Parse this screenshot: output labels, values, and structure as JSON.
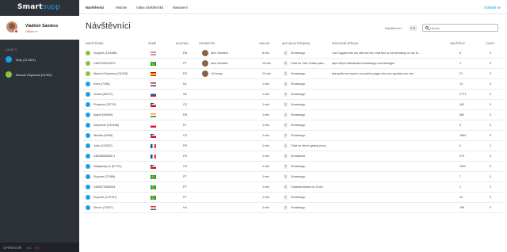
{
  "app": {
    "logo_main": "Smart",
    "logo_accent": "supp"
  },
  "user": {
    "name": "Vladimír Sandera",
    "status": "Offline"
  },
  "sidebar": {
    "chats_label": "CHATY",
    "chats": [
      {
        "label": "Amy (117501)",
        "type": "desktop"
      },
      {
        "label": "Manuel Espinosa (21003)",
        "type": "mobile"
      }
    ],
    "operators": {
      "label": "OPERÁTOŘI",
      "online": "1",
      "offline": "3"
    }
  },
  "nav": {
    "items": [
      "Návštěvníci",
      "Historie",
      "Videa návštěvníků",
      "Nastavení"
    ],
    "logout": "Odhlásit se"
  },
  "page": {
    "title": "Návštěvníci",
    "visitors_label": "Návštěvníci",
    "visitors_count": "271",
    "search_placeholder": "Hledat"
  },
  "table": {
    "headers": [
      "NÁVŠTĚVNÍK",
      "ZEMĚ",
      "SKUPINA",
      "OPERÁTOR",
      "ONLINE",
      "AKTUÁLNÍ STRÁNKA",
      "POSLEDNÍ ZPRÁVA",
      "NÁVŠTĚVY",
      "CHATY"
    ],
    "rows": [
      {
        "name": "Support (123488)",
        "flag": "us",
        "group": "EN",
        "operator": "Alex Montero",
        "online": "6 min",
        "pages": "2",
        "page": "Smartsupp",
        "message": "I am logged into my site but the chat box is not showing on my si...",
        "visits": "6",
        "chats": "0",
        "icon": "green"
      },
      {
        "name": "1483755516323",
        "flag": "br",
        "group": "PT",
        "operator": "Alex Montero",
        "online": "15 min",
        "pages": "5",
        "page": "Chat ao Vivo Grátis para...",
        "message": "aqui https://dashboard.smartsupp.com/#widget",
        "visits": "1",
        "chats": "0",
        "icon": "green"
      },
      {
        "name": "Manuel Espinosa (21003)",
        "flag": "es",
        "group": "ES",
        "operator": "Lili Ivany",
        "online": "14 min",
        "pages": "2",
        "page": "Smartsupp",
        "message": "tranquila me espero no puedo pagar sino me ayudan con eso",
        "visits": "21",
        "chats": "3",
        "icon": "green"
      },
      {
        "name": "Kees (7185)",
        "flag": "nl",
        "group": "NL",
        "operator": "",
        "online": "1 min",
        "pages": "2",
        "page": "Smartsupp",
        "message": "",
        "visits": "13",
        "chats": "0",
        "icon": "blue"
      },
      {
        "name": "Zuzka (65797)",
        "flag": "sk",
        "group": "SK",
        "operator": "",
        "online": "1 min",
        "pages": "2",
        "page": "Smartsupp",
        "message": "",
        "visits": "2771",
        "chats": "0",
        "icon": "blue"
      },
      {
        "name": "Podpora (30723)",
        "flag": "cz",
        "group": "CZ",
        "operator": "",
        "online": "1 min",
        "pages": "2",
        "page": "Smartsupp",
        "message": "",
        "visits": "343",
        "chats": "0",
        "icon": "blue"
      },
      {
        "name": "Agent (90800)",
        "flag": "in",
        "group": "EN",
        "operator": "",
        "online": "1 min",
        "pages": "2",
        "page": "Smartsupp",
        "message": "",
        "visits": "680",
        "chats": "0",
        "icon": "blue"
      },
      {
        "name": "Wsparcie (132466)",
        "flag": "pl",
        "group": "PL",
        "operator": "",
        "online": "1 min",
        "pages": "2",
        "page": "Smartsupp",
        "message": "",
        "visits": "9",
        "chats": "0",
        "icon": "blue"
      },
      {
        "name": "Monika (6089)",
        "flag": "cz",
        "group": "CZ",
        "operator": "",
        "online": "1 min",
        "pages": "2",
        "page": "Smartsupp",
        "message": "",
        "visits": "1654",
        "chats": "0",
        "icon": "blue"
      },
      {
        "name": "Julia (113322)",
        "flag": "fr",
        "group": "FR",
        "operator": "",
        "online": "1 min",
        "pages": "1",
        "page": "Chat en direct gratuit pour...",
        "message": "",
        "visits": "6",
        "chats": "1",
        "icon": "blue"
      },
      {
        "name": "1482860654871",
        "flag": "fr",
        "group": "FR",
        "operator": "",
        "online": "1 min",
        "pages": "2",
        "page": "Smartbook",
        "message": "",
        "visits": "473",
        "chats": "0",
        "icon": "blue"
      },
      {
        "name": "Nataplody.cz (57791)",
        "flag": "cz",
        "group": "CZ",
        "operator": "",
        "online": "1 min",
        "pages": "2",
        "page": "Smartsupp",
        "message": "",
        "visits": "1033",
        "chats": "0",
        "icon": "blue"
      },
      {
        "name": "Suporte (71366)",
        "flag": "br",
        "group": "PT",
        "operator": "",
        "online": "1 min",
        "pages": "2",
        "page": "Smartsupp",
        "message": "",
        "visits": "7",
        "chats": "0",
        "icon": "blue"
      },
      {
        "name": "1485673680054",
        "flag": "br",
        "group": "PT",
        "operator": "",
        "online": "1 min",
        "pages": "2",
        "page": "Características do Chat...",
        "message": "",
        "visits": "1",
        "chats": "0",
        "icon": "blue"
      },
      {
        "name": "Suporte (122787)",
        "flag": "br",
        "group": "PT",
        "operator": "",
        "online": "1 min",
        "pages": "2",
        "page": "Smartsupp",
        "message": "",
        "visits": "34",
        "chats": "0",
        "icon": "blue"
      },
      {
        "name": "Simon (75157)",
        "flag": "hu",
        "group": "HU",
        "operator": "",
        "online": "1 min",
        "pages": "2",
        "page": "Smartsupp",
        "message": "",
        "visits": "198",
        "chats": "0",
        "icon": "blue"
      }
    ]
  }
}
